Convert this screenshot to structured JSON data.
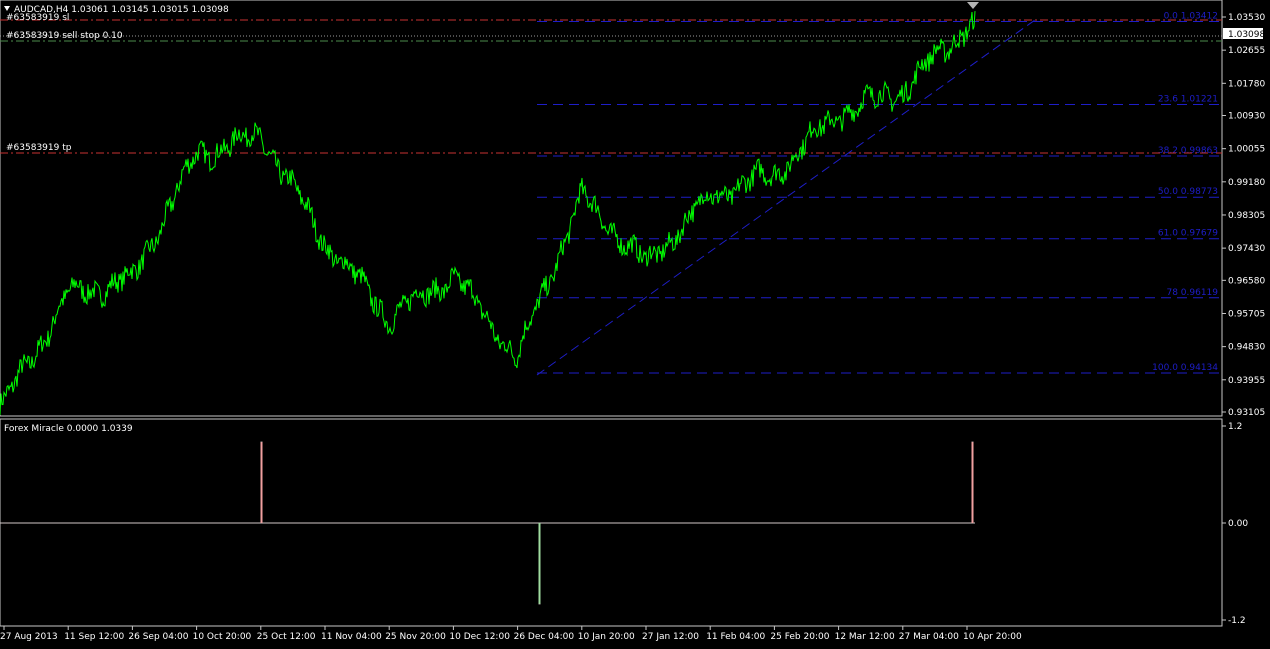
{
  "main_panel": {
    "header": "AUDCAD,H4  1.03061 1.03145 1.03015 1.03098",
    "price_scale": [
      "1.03530",
      "1.02655",
      "1.01780",
      "1.00930",
      "1.00055",
      "0.99180",
      "0.98305",
      "0.97430",
      "0.96580",
      "0.95705",
      "0.94830",
      "0.93955",
      "0.93105"
    ],
    "current_price": "1.03098",
    "order_labels": {
      "sl": "#63583919 sl",
      "sell_stop": "#63583919 sell stop 0.10",
      "tp": "#63583919 tp"
    },
    "fib_levels": [
      {
        "label": "0.0  1.03412",
        "price": 1.03412
      },
      {
        "label": "23.6  1.01221",
        "price": 1.01221
      },
      {
        "label": "38.2  0.99863",
        "price": 0.99863
      },
      {
        "label": "50.0  0.98773",
        "price": 0.98773
      },
      {
        "label": "61.0  0.97679",
        "price": 0.97679
      },
      {
        "label": "78  0.96119",
        "price": 0.96119
      },
      {
        "label": "100.0  0.94134",
        "price": 0.94134
      }
    ]
  },
  "indicator_panel": {
    "header": "Forex Miracle 0.0000 1.0339",
    "scale": [
      "1.2",
      "0.00",
      "-1.2"
    ]
  },
  "time_axis": [
    "27 Aug 2013",
    "11 Sep 12:00",
    "26 Sep 04:00",
    "10 Oct 20:00",
    "25 Oct 12:00",
    "11 Nov 04:00",
    "25 Nov 20:00",
    "10 Dec 12:00",
    "26 Dec 04:00",
    "10 Jan 20:00",
    "27 Jan 12:00",
    "11 Feb 04:00",
    "25 Feb 20:00",
    "12 Mar 12:00",
    "27 Mar 04:00",
    "10 Apr 20:00"
  ],
  "colors": {
    "background": "#000000",
    "price_line": "#00ff00",
    "fib": "#1e1ec8",
    "stop_line": "#c83232",
    "pending_line": "#4b8c4b",
    "indicator": "#d2c8c8",
    "signal_up": "#f0a0a0",
    "signal_down": "#a0dca0"
  },
  "chart_data": [
    {
      "type": "line",
      "title": "AUDCAD,H4",
      "ylim": [
        0.93105,
        1.0353
      ],
      "series": [
        {
          "name": "AUDCAD",
          "x": [
            "27 Aug 2013",
            "11 Sep 12:00",
            "26 Sep 04:00",
            "10 Oct 20:00",
            "25 Oct 12:00",
            "11 Nov 04:00",
            "25 Nov 20:00",
            "10 Dec 12:00",
            "26 Dec 04:00",
            "10 Jan 20:00",
            "27 Jan 12:00",
            "11 Feb 04:00",
            "25 Feb 20:00",
            "12 Mar 12:00",
            "27 Mar 04:00",
            "10 Apr 20:00"
          ],
          "values": [
            0.933,
            0.962,
            0.966,
            0.999,
            1.004,
            0.976,
            0.956,
            0.967,
            0.9455,
            0.988,
            0.97,
            0.988,
            0.994,
            1.01,
            1.016,
            1.033
          ]
        }
      ]
    },
    {
      "type": "line",
      "title": "Forex Miracle",
      "ylim": [
        -1.2,
        1.2
      ],
      "series": [
        {
          "name": "Forex Miracle",
          "x": [
            "25 Oct 12:00",
            "26 Dec 04:00",
            "10 Apr 20:00"
          ],
          "values": [
            1,
            -1,
            1
          ]
        }
      ]
    }
  ]
}
